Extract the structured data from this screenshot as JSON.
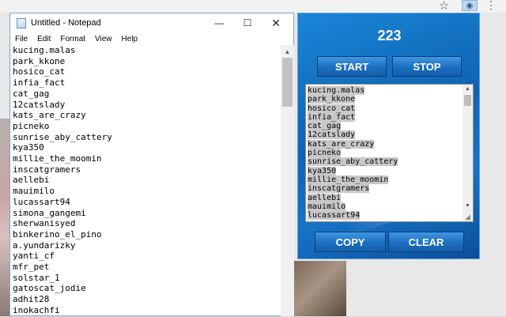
{
  "browser": {
    "star_glyph": "☆",
    "extension_glyph": "◉",
    "menu_glyph": "⋮"
  },
  "notepad": {
    "title": "Untitled - Notepad",
    "window_buttons": {
      "minimize": "—",
      "maximize": "☐",
      "close": "✕"
    },
    "menu": [
      "File",
      "Edit",
      "Format",
      "View",
      "Help"
    ],
    "lines": [
      "kucing.malas",
      "park_kkone",
      "hosico_cat",
      "infia_fact",
      "cat_gag",
      "12catslady",
      "kats_are_crazy",
      "picneko",
      "sunrise_aby_cattery",
      "kya350",
      "millie_the_moomin",
      "inscatgramers",
      "aellebi",
      "mauimilo",
      "lucassart94",
      "simona_gangemi",
      "sherwanisyed",
      "binkerino_el_pino",
      "a.yundarizky",
      "yanti_cf",
      "mfr_pet",
      "solstar_1",
      "gatoscat_jodie",
      "adhit28",
      "inokachfi"
    ]
  },
  "popup": {
    "count": "223",
    "start_label": "START",
    "stop_label": "STOP",
    "copy_label": "COPY",
    "clear_label": "CLEAR",
    "textarea_lines": [
      "kucing.malas",
      "park_kkone",
      "hosico_cat",
      "infia_fact",
      "cat_gag",
      "12catslady",
      "kats_are_crazy",
      "picneko",
      "sunrise_aby_cattery",
      "kya350",
      "millie_the_moomin",
      "inscatgramers",
      "aellebi",
      "mauimilo",
      "lucassart94"
    ]
  },
  "colors": {
    "popup_blue": "#1773c6",
    "button_blue": "#1b6fc0",
    "selection_gray": "#c8c8c8"
  }
}
